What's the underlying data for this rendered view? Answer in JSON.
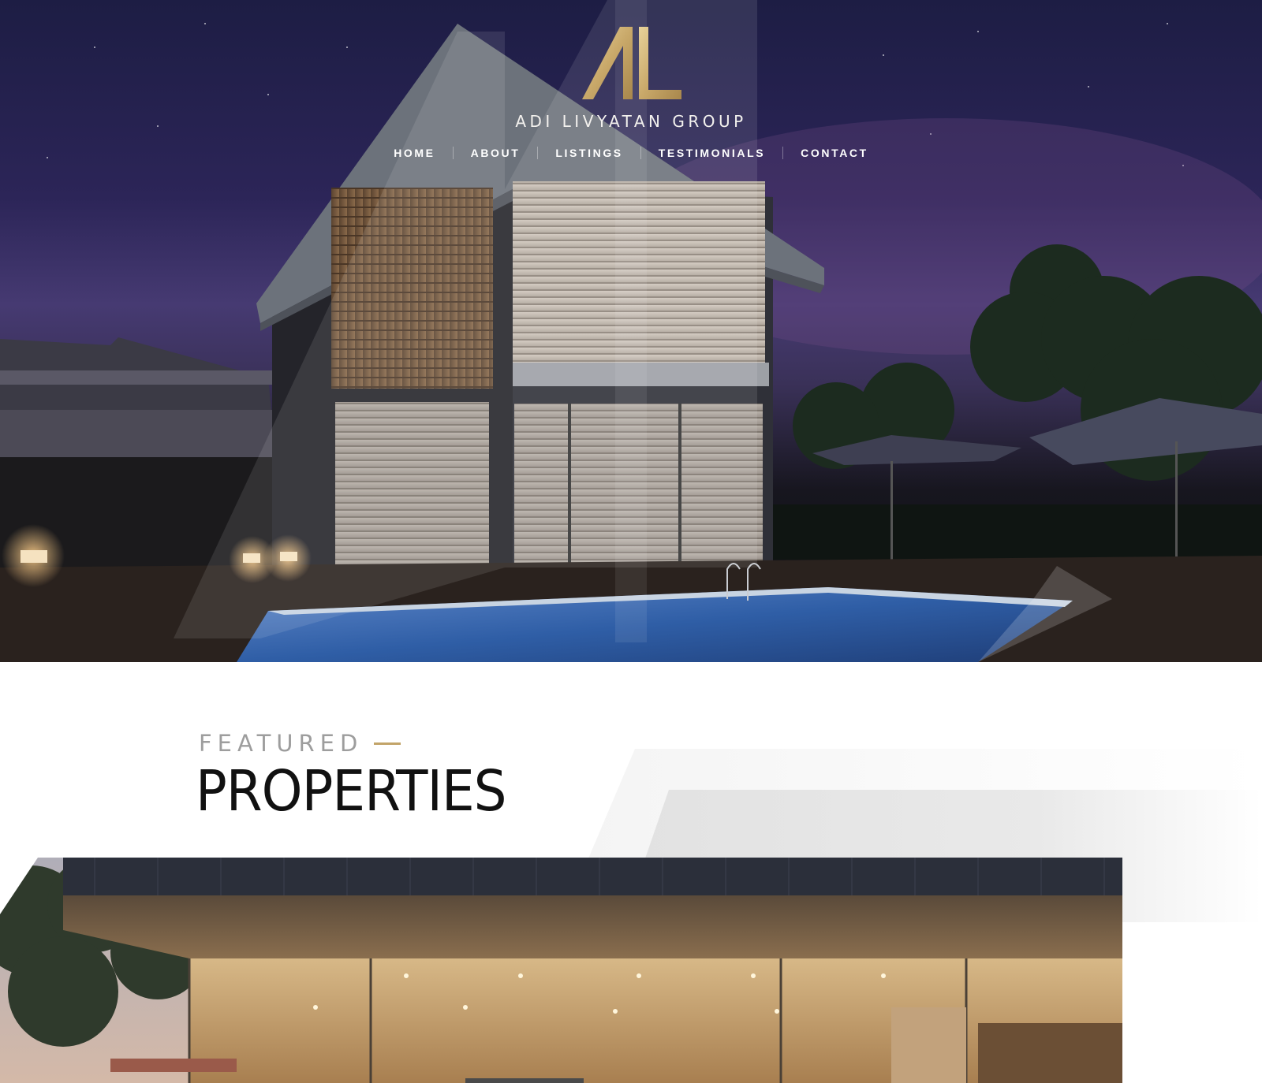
{
  "brand": {
    "logo_letters": "AL",
    "name": "ADI LIVYATAN GROUP",
    "gold": "#c9a96a"
  },
  "nav": {
    "items": [
      {
        "label": "HOME"
      },
      {
        "label": "ABOUT"
      },
      {
        "label": "LISTINGS"
      },
      {
        "label": "TESTIMONIALS"
      },
      {
        "label": "CONTACT"
      }
    ]
  },
  "featured": {
    "kicker": "FEATURED",
    "headline": "PROPERTIES",
    "accent": "#c2a469"
  },
  "icons": [
    "brand-logo-icon"
  ]
}
